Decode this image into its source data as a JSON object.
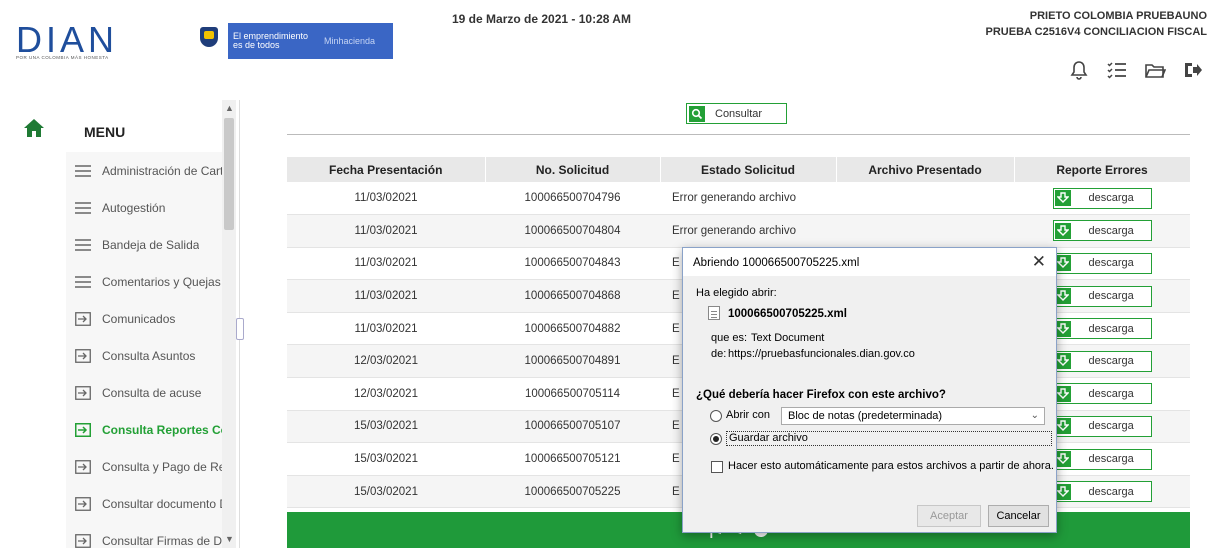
{
  "header": {
    "logo_text": "DIAN",
    "logo_slogan": "POR UNA COLOMBIA MÁS HONESTA",
    "gov_banner_left": "El emprendimiento es de todos",
    "gov_banner_right": "Minhacienda",
    "datetime": "19 de Marzo de 2021 - 10:28 AM",
    "user_name": "PRIETO COLOMBIA PRUEBAUNO",
    "company": "PRUEBA C2516V4 CONCILIACION FISCAL",
    "icons": [
      "bell-icon",
      "checklist-icon",
      "folder-icon",
      "logout-icon"
    ]
  },
  "sidebar": {
    "title": "MENU",
    "items": [
      {
        "label": "Administración de Carte",
        "icon": "hamburger-icon"
      },
      {
        "label": "Autogestión",
        "icon": "hamburger-icon"
      },
      {
        "label": "Bandeja de Salida",
        "icon": "hamburger-icon"
      },
      {
        "label": "Comentarios y Quejas",
        "icon": "hamburger-icon"
      },
      {
        "label": "Comunicados",
        "icon": "arrow-box-icon"
      },
      {
        "label": "Consulta Asuntos",
        "icon": "arrow-box-icon"
      },
      {
        "label": "Consulta de acuse",
        "icon": "arrow-box-icon"
      },
      {
        "label": "Consulta Reportes Con",
        "icon": "arrow-box-icon",
        "active": true
      },
      {
        "label": "Consulta y Pago de Rec",
        "icon": "arrow-box-icon"
      },
      {
        "label": "Consultar documento D",
        "icon": "arrow-box-icon"
      },
      {
        "label": "Consultar Firmas de Do",
        "icon": "arrow-box-icon"
      }
    ]
  },
  "main": {
    "consultar_label": "Consultar",
    "columns": [
      "Fecha Presentación",
      "No. Solicitud",
      "Estado Solicitud",
      "Archivo Presentado",
      "Reporte Errores"
    ],
    "rows": [
      {
        "fecha": "11/03/02021",
        "solicitud": "100066500704796",
        "estado": "Error generando archivo",
        "archivo": "",
        "reporte": "descarga"
      },
      {
        "fecha": "11/03/02021",
        "solicitud": "100066500704804",
        "estado": "Error generando archivo",
        "archivo": "",
        "reporte": "descarga"
      },
      {
        "fecha": "11/03/02021",
        "solicitud": "100066500704843",
        "estado": "E",
        "archivo": "",
        "reporte": "descarga"
      },
      {
        "fecha": "11/03/02021",
        "solicitud": "100066500704868",
        "estado": "E",
        "archivo": "",
        "reporte": "descarga"
      },
      {
        "fecha": "11/03/02021",
        "solicitud": "100066500704882",
        "estado": "E",
        "archivo": "",
        "reporte": "descarga"
      },
      {
        "fecha": "12/03/02021",
        "solicitud": "100066500704891",
        "estado": "E",
        "archivo": "",
        "reporte": "descarga"
      },
      {
        "fecha": "12/03/02021",
        "solicitud": "100066500705114",
        "estado": "E",
        "archivo": "",
        "reporte": "descarga"
      },
      {
        "fecha": "15/03/02021",
        "solicitud": "100066500705107",
        "estado": "E",
        "archivo": "",
        "reporte": "descarga"
      },
      {
        "fecha": "15/03/02021",
        "solicitud": "100066500705121",
        "estado": "E",
        "archivo": "",
        "reporte": "descarga"
      },
      {
        "fecha": "15/03/02021",
        "solicitud": "100066500705225",
        "estado": "E",
        "archivo": "",
        "reporte": "descarga"
      }
    ],
    "pager_first": "|<",
    "pager_prev": "<"
  },
  "dialog": {
    "title": "Abriendo 100066500705225.xml",
    "chosen_label": "Ha elegido abrir:",
    "filename": "100066500705225.xml",
    "type_label": "que es:",
    "type_value": "Text Document",
    "from_label": "de:",
    "from_value": "https://pruebasfuncionales.dian.gov.co",
    "question": "¿Qué debería hacer Firefox con este archivo?",
    "open_with_label": "Abrir con",
    "open_with_app": "Bloc de notas (predeterminada)",
    "save_label": "Guardar archivo",
    "auto_label": "Hacer esto automáticamente para estos archivos a partir de ahora.",
    "accept_label": "Aceptar",
    "cancel_label": "Cancelar",
    "selected_option": "save"
  },
  "colors": {
    "dian_blue": "#1f4e9c",
    "green": "#23a036",
    "pager_green": "#1f9a3a",
    "gov_blue": "#3a66c5"
  }
}
